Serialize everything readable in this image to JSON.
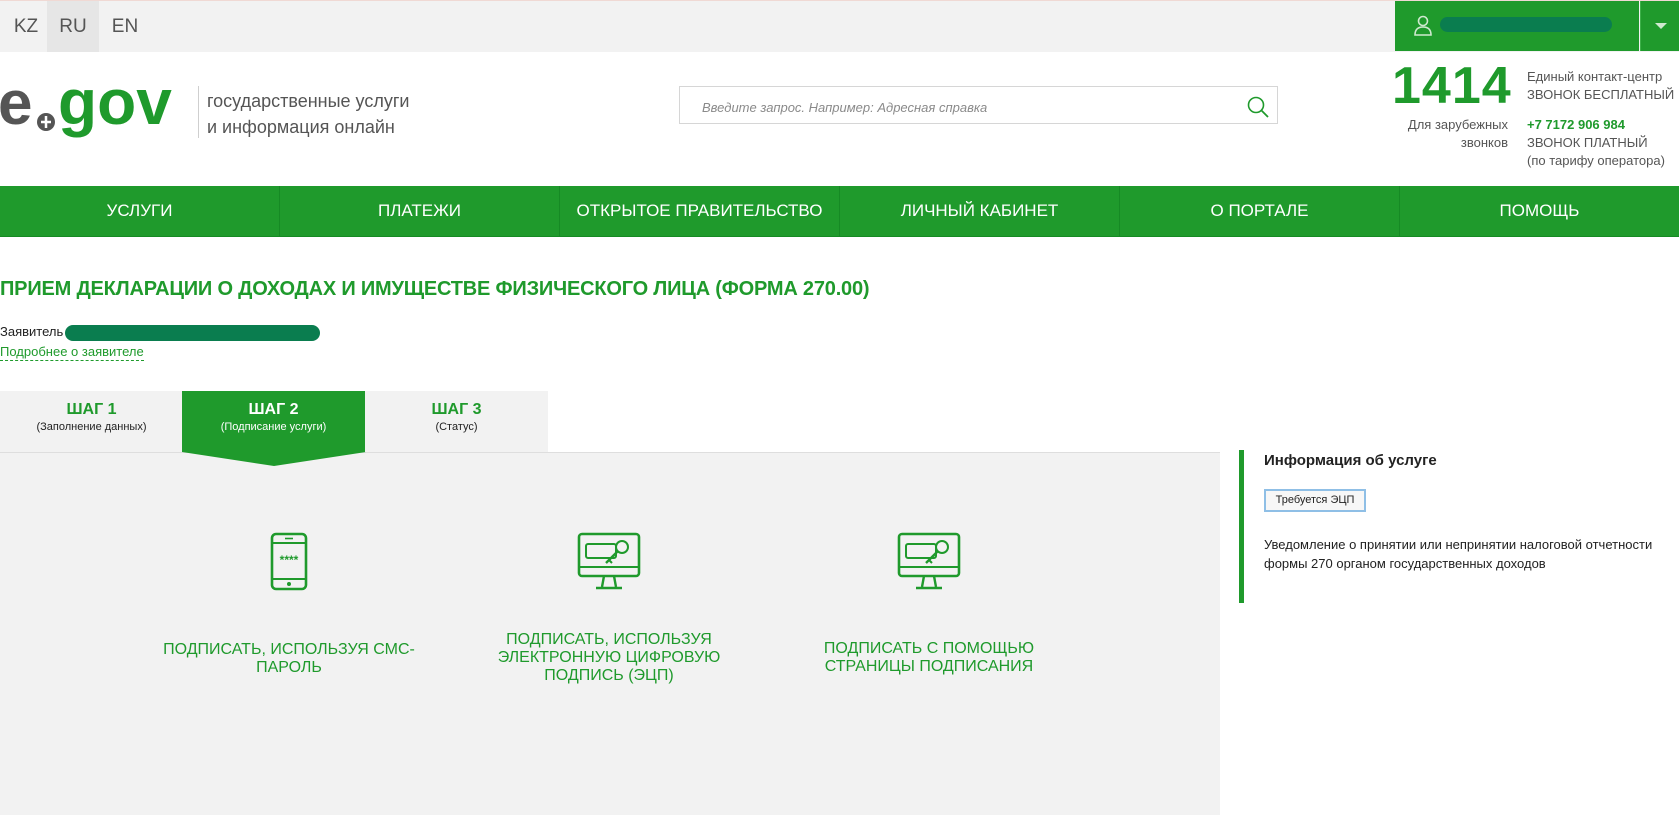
{
  "languages": [
    "KZ",
    "RU",
    "EN"
  ],
  "active_language": "RU",
  "header": {
    "tagline_line1": "государственные услуги",
    "tagline_line2": "и информация онлайн",
    "search_placeholder": "Введите запрос. Например: Адресная справка",
    "contact_number": "1414",
    "contact_center": "Единый контакт-центр",
    "free_call": "ЗВОНОК БЕСПЛАТНЫЙ",
    "foreign_calls": "Для зарубежных звонков",
    "paid_phone": "+7 7172 906 984",
    "paid_call": "ЗВОНОК ПЛАТНЫЙ",
    "operator_tariff": "(по тарифу оператора)"
  },
  "nav": [
    "УСЛУГИ",
    "ПЛАТЕЖИ",
    "ОТКРЫТОЕ ПРАВИТЕЛЬСТВО",
    "ЛИЧНЫЙ КАБИНЕТ",
    "О ПОРТАЛЕ",
    "ПОМОЩЬ"
  ],
  "page": {
    "title": "ПРИЕМ ДЕКЛАРАЦИИ О ДОХОДАХ И ИМУЩЕСТВЕ ФИЗИЧЕСКОГО ЛИЦА (ФОРМА 270.00)",
    "applicant_label": "Заявитель",
    "more_link": "Подробнее о заявителе"
  },
  "steps": [
    {
      "title": "ШАГ 1",
      "subtitle": "(Заполнение данных)",
      "active": false
    },
    {
      "title": "ШАГ 2",
      "subtitle": "(Подписание услуги)",
      "active": true
    },
    {
      "title": "ШАГ 3",
      "subtitle": "(Статус)",
      "active": false
    }
  ],
  "sign_options": [
    {
      "label": "ПОДПИСАТЬ, ИСПОЛЬЗУЯ СМС-ПАРОЛЬ",
      "icon": "smartphone-password-icon"
    },
    {
      "label": "ПОДПИСАТЬ, ИСПОЛЬЗУЯ ЭЛЕКТРОННУЮ ЦИФРОВУЮ ПОДПИСЬ (ЭЦП)",
      "icon": "monitor-key-icon"
    },
    {
      "label": "ПОДПИСАТЬ С ПОМОЩЬЮ СТРАНИЦЫ ПОДПИСАНИЯ",
      "icon": "monitor-key-icon"
    }
  ],
  "service_info": {
    "heading": "Информация об услуге",
    "badge": "Требуется ЭЦП",
    "description": "Уведомление о принятии или непринятии налоговой отчетности формы 270 органом государственных доходов"
  },
  "colors": {
    "brand_green": "#1f9a2c",
    "panel_grey": "#f2f2f2"
  }
}
